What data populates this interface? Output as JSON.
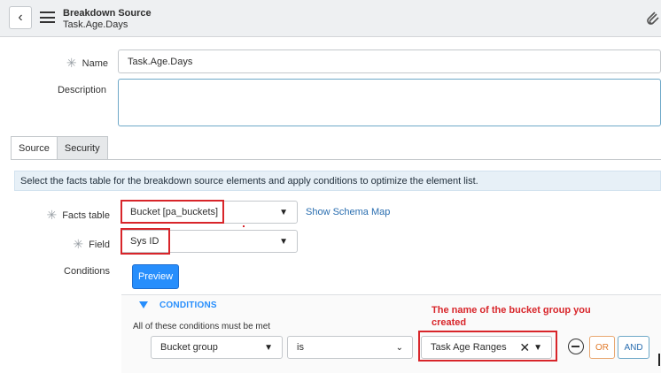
{
  "header": {
    "title": "Breakdown Source",
    "subtitle": "Task.Age.Days"
  },
  "form": {
    "name_label": "Name",
    "name_value": "Task.Age.Days",
    "description_label": "Description",
    "description_value": ""
  },
  "tabs": [
    {
      "label": "Source",
      "active": true
    },
    {
      "label": "Security",
      "active": false
    }
  ],
  "info_text": "Select the facts table for the breakdown source elements and apply conditions to optimize the element list.",
  "facts_table": {
    "label": "Facts table",
    "value": "Bucket [pa_buckets]",
    "link": "Show Schema Map"
  },
  "field": {
    "label": "Field",
    "value": "Sys ID"
  },
  "conditions": {
    "label": "Conditions",
    "preview_label": "Preview",
    "header": "CONDITIONS",
    "description": "All of these conditions must be met",
    "row": {
      "field": "Bucket group",
      "operator": "is",
      "value": "Task Age Ranges"
    },
    "or_label": "OR",
    "and_label": "AND"
  },
  "annotation": "The name of the bucket group you created",
  "colors": {
    "accent": "#278efc",
    "highlight": "#d8252a",
    "info_bg": "#e7f0f7",
    "or": "#e07a2a"
  },
  "icons": [
    "chevron-left-icon",
    "hamburger-menu-icon",
    "paperclip-icon",
    "required-asterisk-icon",
    "dropdown-caret-icon",
    "collapse-triangle-icon",
    "clear-x-icon",
    "remove-condition-icon"
  ]
}
